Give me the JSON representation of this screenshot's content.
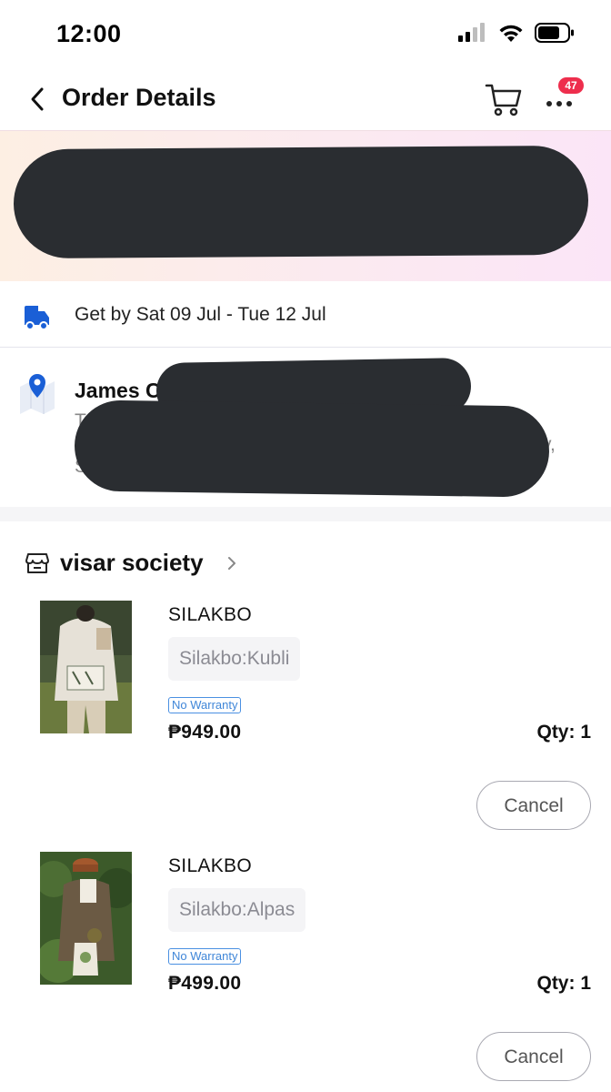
{
  "status_bar": {
    "time": "12:00"
  },
  "header": {
    "title": "Order Details",
    "cart_badge": "47"
  },
  "delivery": {
    "text": "Get by Sat 09 Jul - Tue 12 Jul"
  },
  "address": {
    "name_visible": "James C",
    "line_fragment": "T",
    "line_end": "y,",
    "line_start_2": "S"
  },
  "shop": {
    "name": "visar society"
  },
  "items": [
    {
      "name": "SILAKBO",
      "variant": "Silakbo:Kubli",
      "warranty": "No Warranty",
      "price": "₱949.00",
      "qty": "Qty: 1",
      "cancel_label": "Cancel"
    },
    {
      "name": "SILAKBO",
      "variant": "Silakbo:Alpas",
      "warranty": "No Warranty",
      "price": "₱499.00",
      "qty": "Qty: 1",
      "cancel_label": "Cancel"
    }
  ],
  "colors": {
    "badge": "#ee2e4d",
    "delivery_icon": "#1a5fd6",
    "warranty": "#3f86d8",
    "redaction": "#2a2d31"
  }
}
